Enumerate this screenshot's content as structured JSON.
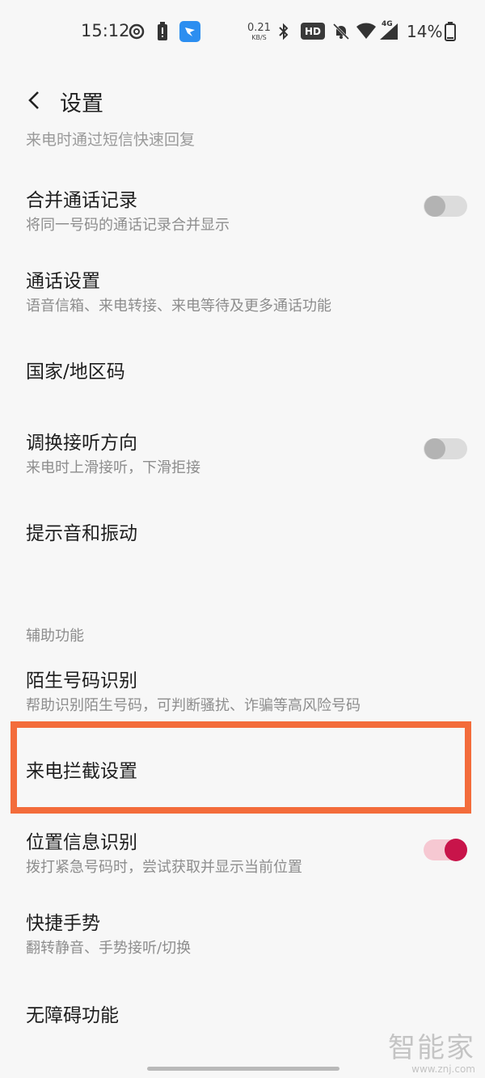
{
  "status_bar": {
    "time": "15:12",
    "net_speed_value": "0.21",
    "net_speed_unit": "KB/S",
    "hd": "HD",
    "network": "4G",
    "battery": "14%"
  },
  "app_bar": {
    "title": "设置"
  },
  "cut_off_text": "来电时通过短信快速回复",
  "rows": [
    {
      "title": "合并通话记录",
      "subtitle": "将同一号码的通话记录合并显示"
    },
    {
      "title": "通话设置",
      "subtitle": "语音信箱、来电转接、来电等待及更多通话功能"
    },
    {
      "title": "国家/地区码"
    },
    {
      "title": "调换接听方向",
      "subtitle": "来电时上滑接听，下滑拒接"
    },
    {
      "title": "提示音和振动"
    }
  ],
  "section": {
    "header": "辅助功能"
  },
  "assist_rows": [
    {
      "title": "陌生号码识别",
      "subtitle": "帮助识别陌生号码，可判断骚扰、诈骗等高风险号码"
    },
    {
      "title": "来电拦截设置"
    },
    {
      "title": "位置信息识别",
      "subtitle": "拨打紧急号码时，尝试获取并显示当前位置"
    },
    {
      "title": "快捷手势",
      "subtitle": "翻转静音、手势接听/切换"
    },
    {
      "title": "无障碍功能"
    }
  ],
  "toggles": {
    "merge_call_log": false,
    "swap_answer_direction": false,
    "location_info": true
  },
  "colors": {
    "background": "#f7f7f7",
    "highlight": "#f36c3b",
    "toggle_on": "#c8144a"
  },
  "watermark": {
    "logo": "智能家",
    "url": "www.znj.com"
  }
}
